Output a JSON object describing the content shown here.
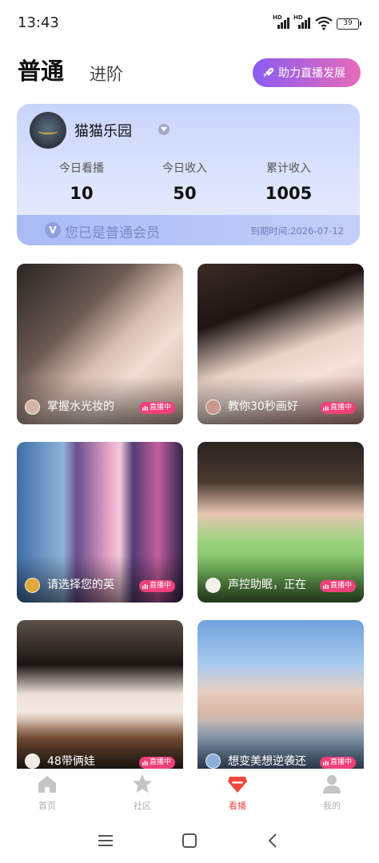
{
  "status_bar": {
    "time": "13:43",
    "signal1_label": "HD",
    "signal2_label": "HD",
    "battery": "39"
  },
  "header": {
    "tab_basic": "普通",
    "tab_advanced": "进阶",
    "boost_button": "助力直播发展"
  },
  "member_card": {
    "nickname": "猫猫乐园",
    "stats": [
      {
        "label": "今日看播",
        "value": "10"
      },
      {
        "label": "今日收入",
        "value": "50"
      },
      {
        "label": "累计收入",
        "value": "1005"
      }
    ],
    "badge_letter": "V",
    "membership_text": "您已是普通会员",
    "expire_text": "到期时间:2026-07-12"
  },
  "live_badge_label": "直播中",
  "streams": [
    {
      "title": "掌握水光妆的"
    },
    {
      "title": "教你30秒画好"
    },
    {
      "title": "请选择您的英"
    },
    {
      "title": "声控助眠，正在"
    },
    {
      "title": "48带俩娃"
    },
    {
      "title": "想变美想逆袭还"
    }
  ],
  "bottom_nav": [
    {
      "label": "首页",
      "icon": "home-icon"
    },
    {
      "label": "社区",
      "icon": "star-icon"
    },
    {
      "label": "看播",
      "icon": "gem-icon",
      "active": true
    },
    {
      "label": "我的",
      "icon": "person-icon"
    }
  ],
  "colors": {
    "accent": "#f0473f",
    "live": "#f0407a",
    "boost_start": "#8a5cf2",
    "boost_end": "#e86bb8"
  }
}
